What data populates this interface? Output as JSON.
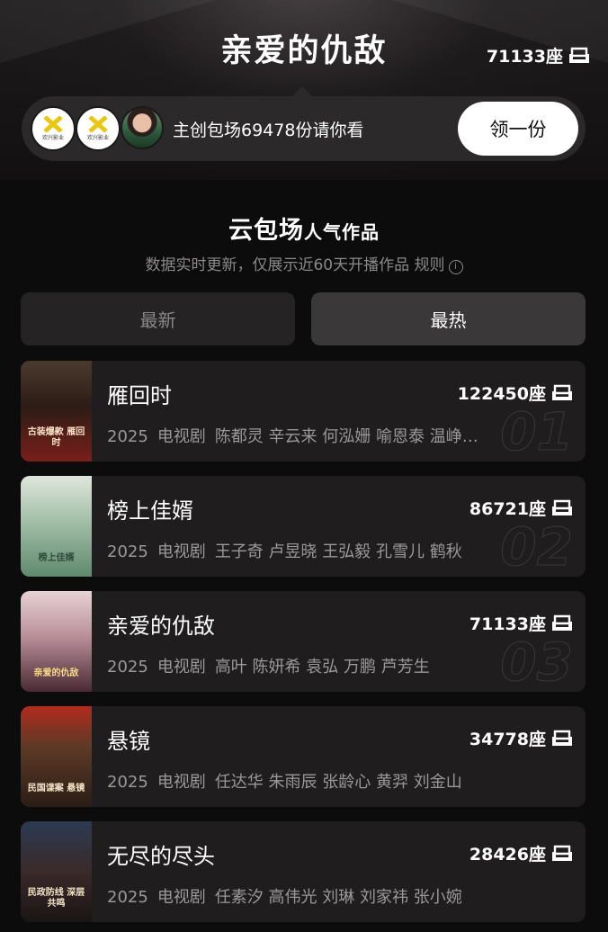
{
  "header": {
    "title": "亲爱的仇敌",
    "seat_count": "71133座"
  },
  "promo": {
    "logo_label": "欢兴影业",
    "text": "主创包场69478份请你看",
    "button_label": "领一份"
  },
  "section": {
    "title_main": "云包场",
    "title_small": "人气作品",
    "subtitle": "数据实时更新，仅展示近60天开播作品 规则",
    "info_icon": "info-icon"
  },
  "tabs": [
    {
      "label": "最新",
      "active": false
    },
    {
      "label": "最热",
      "active": true
    }
  ],
  "colors": {
    "background": "#0d0c0d",
    "card": "#1f1d1e",
    "promo_bg": "#2b292a",
    "muted_text": "#8a8889"
  },
  "items": [
    {
      "title": "雁回时",
      "seats": "122450座",
      "year": "2025",
      "genre": "电视剧",
      "cast": "陈都灵  辛云来  何泓姗  喻恩泰  温峥…",
      "rank": "01",
      "poster_text": "古装爆款 雁回时"
    },
    {
      "title": "榜上佳婿",
      "seats": "86721座",
      "year": "2025",
      "genre": "电视剧",
      "cast": "王子奇  卢昱晓  王弘毅  孔雪儿  鹤秋",
      "rank": "02",
      "poster_text": "榜上佳婿"
    },
    {
      "title": "亲爱的仇敌",
      "seats": "71133座",
      "year": "2025",
      "genre": "电视剧",
      "cast": "高叶  陈妍希  袁弘  万鹏  芦芳生",
      "rank": "03",
      "poster_text": "亲爱的仇敌"
    },
    {
      "title": "悬镜",
      "seats": "34778座",
      "year": "2025",
      "genre": "电视剧",
      "cast": "任达华  朱雨辰  张龄心  黄羿  刘金山",
      "rank": "",
      "poster_text": "民国谍案 悬镜"
    },
    {
      "title": "无尽的尽头",
      "seats": "28426座",
      "year": "2025",
      "genre": "电视剧",
      "cast": "任素汐  高伟光  刘琳  刘家祎  张小婉",
      "rank": "",
      "poster_text": "民政防线 深层共鸣"
    }
  ]
}
